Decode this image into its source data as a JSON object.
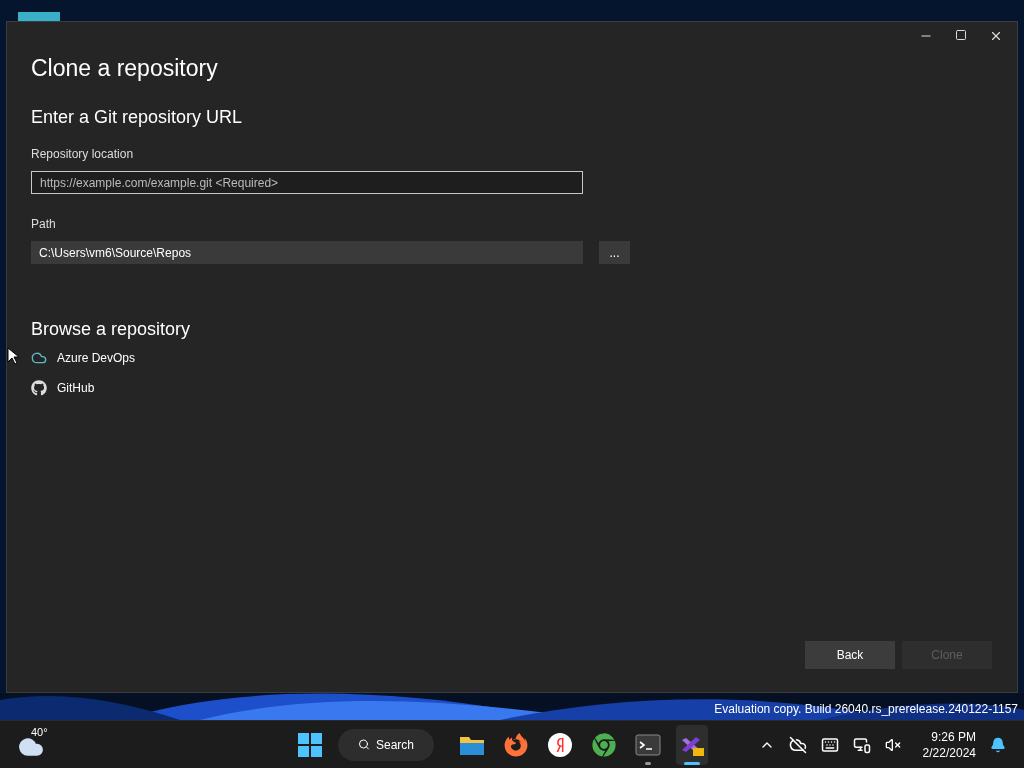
{
  "window": {
    "title": "Clone a repository",
    "url_section": {
      "heading": "Enter a Git repository URL",
      "location": {
        "label": "Repository location",
        "placeholder": "https://example.com/example.git <Required>",
        "focused": true
      },
      "path": {
        "label": "Path",
        "value": "C:\\Users\\vm6\\Source\\Repos",
        "browse": "..."
      }
    },
    "browse_section": {
      "heading": "Browse a repository",
      "items": [
        {
          "kind": "cloud",
          "label": "Azure DevOps"
        },
        {
          "kind": "github",
          "label": "GitHub"
        }
      ]
    },
    "buttons": [
      {
        "label": "Back",
        "disabled": false
      },
      {
        "label": "Clone",
        "disabled": true
      }
    ]
  },
  "desktop": {
    "watermark": "Evaluation copy. Build 26040.rs_prerelease.240122-1157"
  },
  "taskbar": {
    "weather": "40°",
    "search": "Search",
    "apps": [
      {
        "kind": "explorer",
        "running": false,
        "active": false
      },
      {
        "kind": "firefox",
        "running": false,
        "active": false
      },
      {
        "kind": "yandex",
        "running": false,
        "active": false
      },
      {
        "kind": "chrome",
        "running": false,
        "active": false
      },
      {
        "kind": "terminal",
        "running": true,
        "active": false
      },
      {
        "kind": "visualstudio",
        "running": true,
        "active": true
      }
    ],
    "time": "9:26 PM",
    "date": "2/22/2024"
  }
}
